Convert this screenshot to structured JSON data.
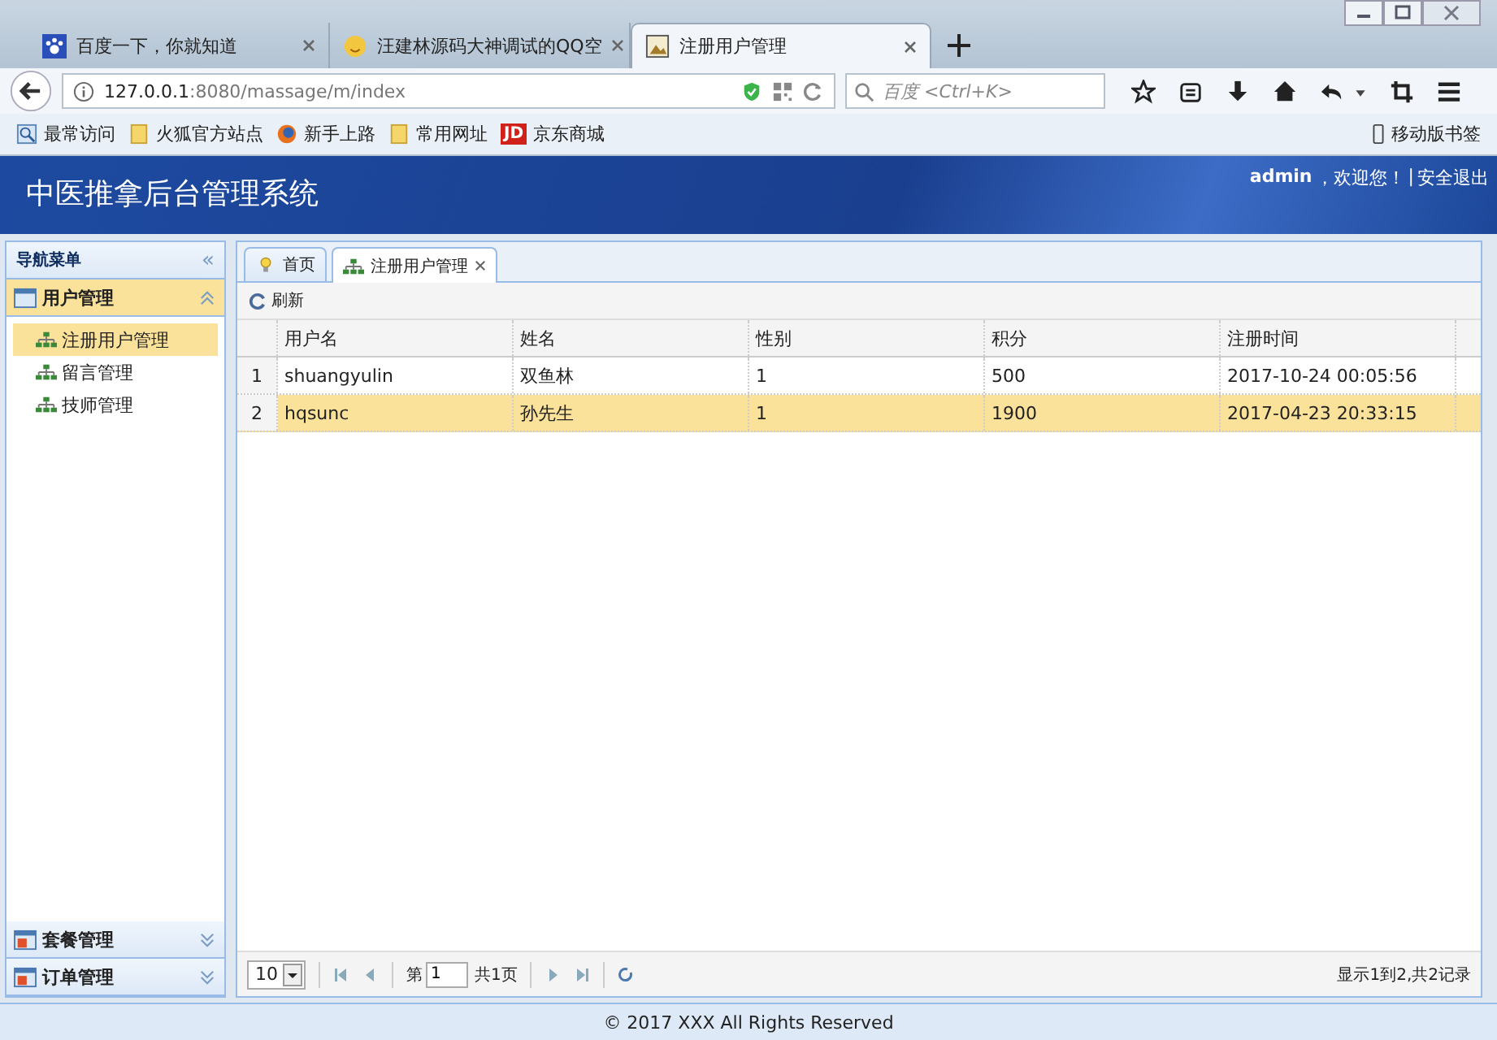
{
  "browser": {
    "tabs": [
      {
        "title": "百度一下，你就知道",
        "kind": "paw",
        "selected": false
      },
      {
        "title": "汪建林源码大神调试的QQ空",
        "kind": "smile",
        "selected": false
      },
      {
        "title": "注册用户管理",
        "kind": "page",
        "selected": true
      }
    ],
    "address": {
      "host": "127.0.0.1",
      "path": ":8080/massage/m/index"
    },
    "search": {
      "placeholder": "百度 <Ctrl+K>"
    },
    "bookmarks": [
      {
        "label": "最常访问",
        "kind": "search"
      },
      {
        "label": "火狐官方站点",
        "kind": "folder"
      },
      {
        "label": "新手上路",
        "kind": "globe"
      },
      {
        "label": "常用网址",
        "kind": "folder"
      },
      {
        "label": "京东商城",
        "kind": "jd",
        "badge": "JD"
      }
    ],
    "mobile_bookmarks": "移动版书签"
  },
  "header": {
    "title": "中医推拿后台管理系统",
    "user": "admin",
    "welcome": "，欢迎您！",
    "separator": "|",
    "logout": "安全退出"
  },
  "sidebar": {
    "title": "导航菜单",
    "collapse": "«",
    "groups": [
      {
        "label": "用户管理",
        "expanded": true,
        "items": [
          {
            "label": "注册用户管理",
            "selected": true
          },
          {
            "label": "留言管理",
            "selected": false
          },
          {
            "label": "技师管理",
            "selected": false
          }
        ]
      },
      {
        "label": "套餐管理",
        "expanded": false
      },
      {
        "label": "订单管理",
        "expanded": false
      }
    ]
  },
  "content_tabs": [
    {
      "label": "首页",
      "kind": "bulb",
      "closable": false,
      "selected": false
    },
    {
      "label": "注册用户管理",
      "kind": "tree",
      "closable": true,
      "selected": true
    }
  ],
  "toolbar": {
    "refresh": "刷新"
  },
  "table": {
    "columns": [
      "用户名",
      "姓名",
      "性别",
      "积分",
      "注册时间"
    ],
    "rows": [
      {
        "num": "1",
        "cells": [
          "shuangyulin",
          "双鱼林",
          "1",
          "500",
          "2017-10-24 00:05:56"
        ],
        "selected": false
      },
      {
        "num": "2",
        "cells": [
          "hqsunc",
          "孙先生",
          "1",
          "1900",
          "2017-04-23 20:33:15"
        ],
        "selected": true
      }
    ]
  },
  "pager": {
    "page_size": "10",
    "page_prefix": "第",
    "page": "1",
    "page_total": "共1页",
    "summary": "显示1到2,共2记录"
  },
  "footer": "© 2017 XXX All Rights Reserved"
}
